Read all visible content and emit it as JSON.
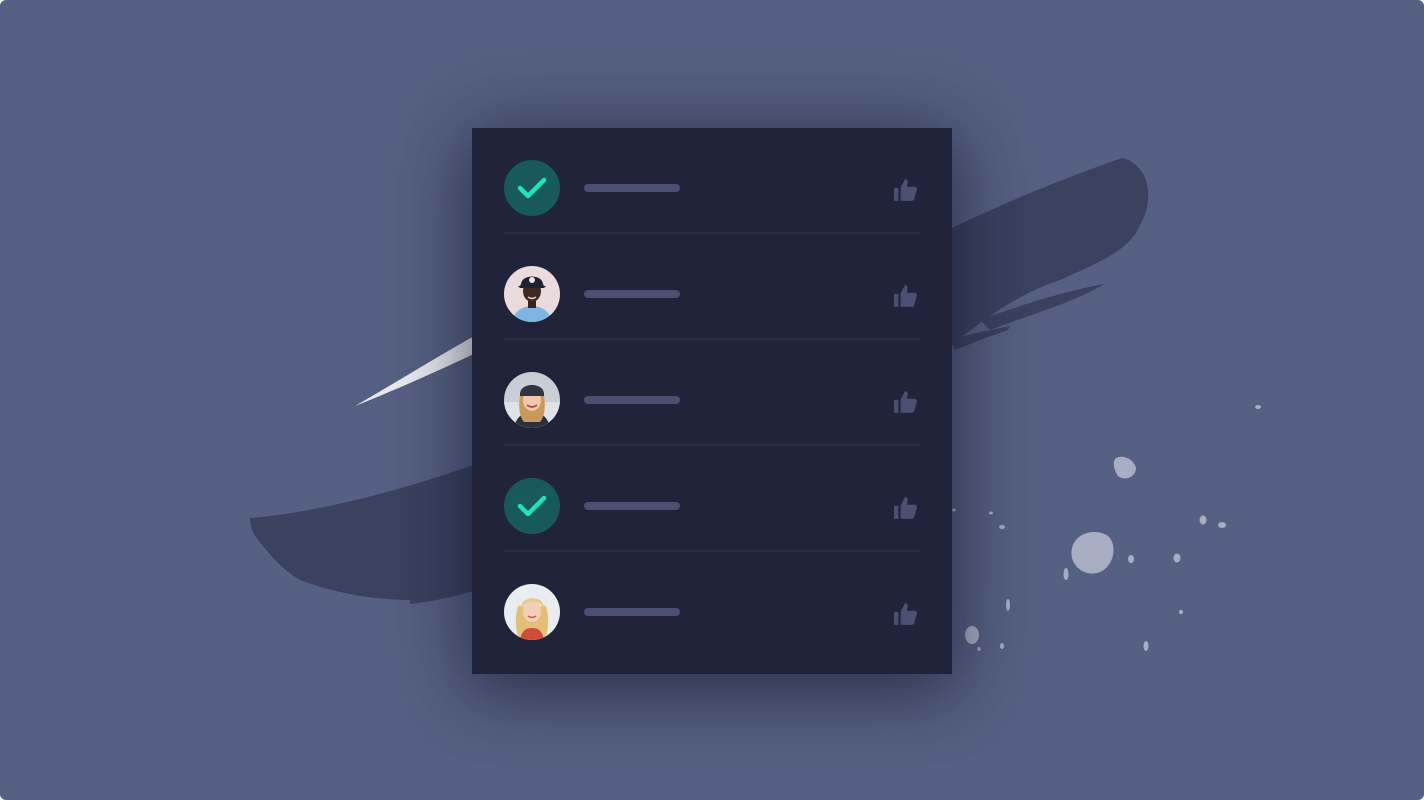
{
  "colors": {
    "background": "#566082",
    "panel": "#202339",
    "divider": "#2a2e46",
    "text_placeholder": "#4b5072",
    "check_circle": "#17595c",
    "check_mark": "#1ee3bc",
    "like_icon": "#4b5072",
    "brush_stroke": "#3a4260",
    "splatter": "#a9adc4"
  },
  "list": {
    "items": [
      {
        "avatar_type": "check",
        "icon": "check-icon",
        "like_icon": "thumbs-up-icon"
      },
      {
        "avatar_type": "photo",
        "icon": "avatar-man-cap",
        "like_icon": "thumbs-up-icon"
      },
      {
        "avatar_type": "photo",
        "icon": "avatar-woman-beanie",
        "like_icon": "thumbs-up-icon"
      },
      {
        "avatar_type": "check",
        "icon": "check-icon",
        "like_icon": "thumbs-up-icon"
      },
      {
        "avatar_type": "photo",
        "icon": "avatar-woman-blonde",
        "like_icon": "thumbs-up-icon"
      }
    ]
  }
}
